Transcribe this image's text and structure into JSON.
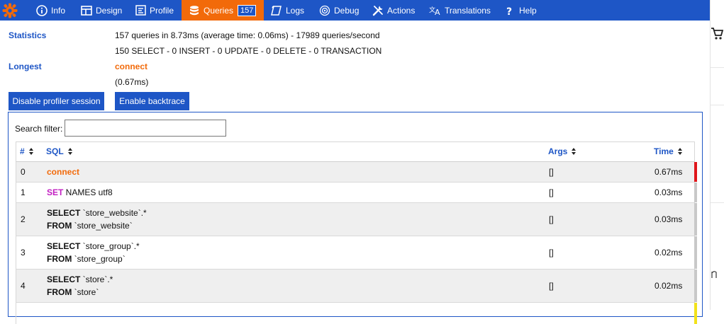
{
  "toolbar": {
    "items": [
      {
        "label": "Info",
        "icon": "info-icon"
      },
      {
        "label": "Design",
        "icon": "layout-icon"
      },
      {
        "label": "Profile",
        "icon": "profile-icon"
      },
      {
        "label": "Queries",
        "icon": "database-icon",
        "badge": "157",
        "active": true
      },
      {
        "label": "Logs",
        "icon": "logs-icon"
      },
      {
        "label": "Debug",
        "icon": "target-icon"
      },
      {
        "label": "Actions",
        "icon": "tools-icon"
      },
      {
        "label": "Translations",
        "icon": "translate-icon"
      },
      {
        "label": "Help",
        "icon": "question-icon"
      }
    ],
    "colors": {
      "bar": "#1e56c6",
      "active": "#f26a0a"
    }
  },
  "stats": {
    "statistics_label": "Statistics",
    "statistics_line1": "157 queries in 8.73ms (average time: 0.06ms) - 17989 queries/second",
    "statistics_line2": "150 SELECT - 0 INSERT - 0 UPDATE - 0 DELETE - 0 TRANSACTION",
    "longest_label": "Longest",
    "longest_query": "connect",
    "longest_time": "(0.67ms)"
  },
  "buttons": {
    "disable_profiler": "Disable profiler session",
    "enable_backtrace": "Enable backtrace"
  },
  "filter": {
    "label": "Search filter:",
    "value": ""
  },
  "table": {
    "headers": {
      "num": "#",
      "sql": "SQL",
      "args": "Args",
      "time": "Time"
    },
    "rows": [
      {
        "num": "0",
        "sql_keyword": "connect",
        "sql_line1_rest": "",
        "sql_line2_keyword": "",
        "sql_line2_rest": "",
        "args": "[]",
        "time": "0.67ms",
        "bar_color": "#e0161b"
      },
      {
        "num": "1",
        "sql_keyword": "SET",
        "sql_line1_rest": " NAMES utf8",
        "sql_line2_keyword": "",
        "sql_line2_rest": "",
        "args": "[]",
        "time": "0.03ms",
        "bar_color": "#c8c8c8"
      },
      {
        "num": "2",
        "sql_keyword": "SELECT",
        "sql_line1_rest": " `store_website`.*",
        "sql_line2_keyword": "FROM",
        "sql_line2_rest": " `store_website`",
        "args": "[]",
        "time": "0.03ms",
        "bar_color": "#c8c8c8"
      },
      {
        "num": "3",
        "sql_keyword": "SELECT",
        "sql_line1_rest": " `store_group`.*",
        "sql_line2_keyword": "FROM",
        "sql_line2_rest": " `store_group`",
        "args": "[]",
        "time": "0.02ms",
        "bar_color": "#c8c8c8"
      },
      {
        "num": "4",
        "sql_keyword": "SELECT",
        "sql_line1_rest": " `store`.*",
        "sql_line2_keyword": "FROM",
        "sql_line2_rest": " `store`",
        "args": "[]",
        "time": "0.02ms",
        "bar_color": "#c8c8c8"
      }
    ]
  }
}
